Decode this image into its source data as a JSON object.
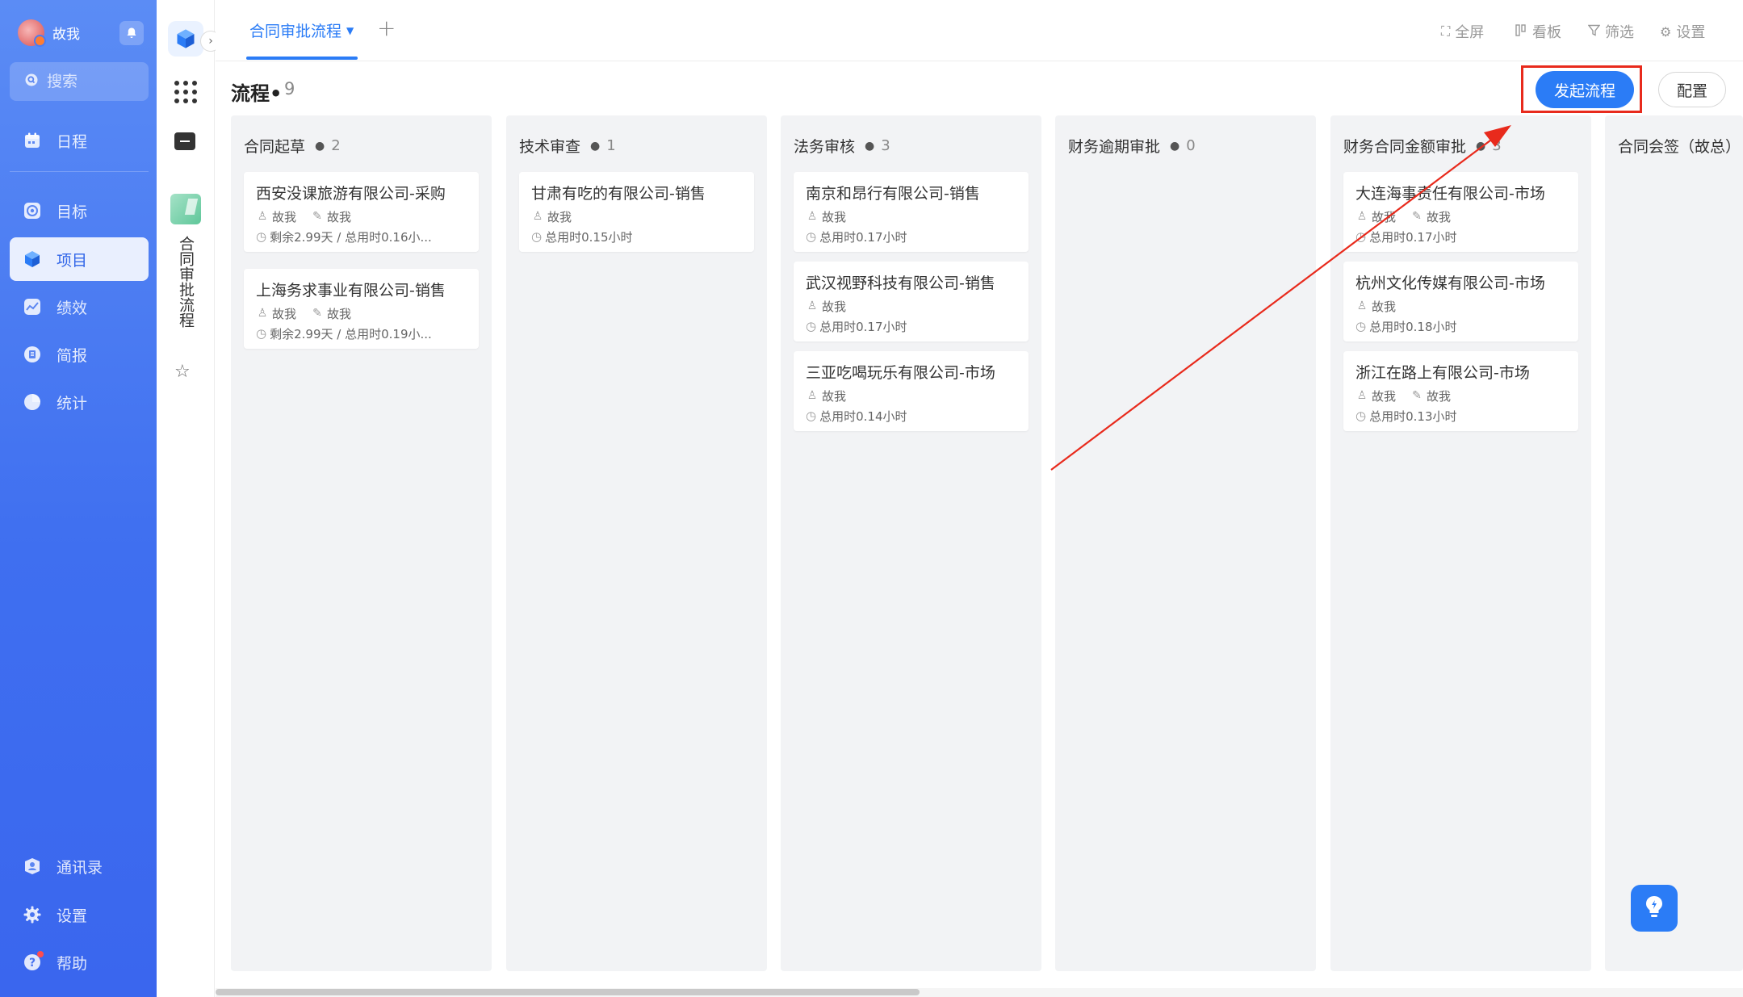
{
  "sidebar": {
    "user_name": "故我",
    "search_placeholder": "搜索",
    "items": [
      {
        "label": "日程",
        "icon": "calendar-icon"
      },
      {
        "label": "目标",
        "icon": "target-icon"
      },
      {
        "label": "项目",
        "icon": "cube-icon",
        "active": true
      },
      {
        "label": "绩效",
        "icon": "chart-icon"
      },
      {
        "label": "简报",
        "icon": "report-icon"
      },
      {
        "label": "统计",
        "icon": "pie-icon"
      }
    ],
    "bottom_items": [
      {
        "label": "通讯录",
        "icon": "contacts-icon"
      },
      {
        "label": "设置",
        "icon": "gear-icon"
      },
      {
        "label": "帮助",
        "icon": "help-icon"
      }
    ]
  },
  "sub_sidebar": {
    "project_name": "合同审批流程"
  },
  "topbar": {
    "active_tab": "合同审批流程",
    "actions": [
      "全屏",
      "看板",
      "筛选",
      "设置"
    ]
  },
  "header": {
    "title": "流程•",
    "count": "9",
    "start_button": "发起流程",
    "config_button": "配置"
  },
  "columns": [
    {
      "title": "合同起草",
      "count": "2",
      "cards": [
        {
          "title": "西安没课旅游有限公司-采购",
          "owner": "故我",
          "approver": "故我",
          "time": "剩余2.99天 / 总用时0.16小..."
        },
        {
          "title": "上海务求事业有限公司-销售",
          "owner": "故我",
          "approver": "故我",
          "time": "剩余2.99天 / 总用时0.19小..."
        }
      ]
    },
    {
      "title": "技术审查",
      "count": "1",
      "cards": [
        {
          "title": "甘肃有吃的有限公司-销售",
          "owner": "故我",
          "approver": "",
          "time": "总用时0.15小时"
        }
      ]
    },
    {
      "title": "法务审核",
      "count": "3",
      "cards": [
        {
          "title": "南京和昂行有限公司-销售",
          "owner": "故我",
          "approver": "",
          "time": "总用时0.17小时"
        },
        {
          "title": "武汉视野科技有限公司-销售",
          "owner": "故我",
          "approver": "",
          "time": "总用时0.17小时"
        },
        {
          "title": "三亚吃喝玩乐有限公司-市场",
          "owner": "故我",
          "approver": "",
          "time": "总用时0.14小时"
        }
      ]
    },
    {
      "title": "财务逾期审批",
      "count": "0",
      "cards": []
    },
    {
      "title": "财务合同金额审批",
      "count": "3",
      "cards": [
        {
          "title": "大连海事责任有限公司-市场",
          "owner": "故我",
          "approver": "故我",
          "time": "总用时0.17小时"
        },
        {
          "title": "杭州文化传媒有限公司-市场",
          "owner": "故我",
          "approver": "",
          "time": "总用时0.18小时"
        },
        {
          "title": "浙江在路上有限公司-市场",
          "owner": "故我",
          "approver": "故我",
          "time": "总用时0.13小时"
        }
      ]
    },
    {
      "title": "合同会签（故总）",
      "count": "",
      "cards": []
    }
  ],
  "colors": {
    "accent": "#2b7cf6",
    "sidebar_top": "#5b8cf5",
    "sidebar_bottom": "#3a66ee",
    "annotation": "#e82a1c"
  }
}
